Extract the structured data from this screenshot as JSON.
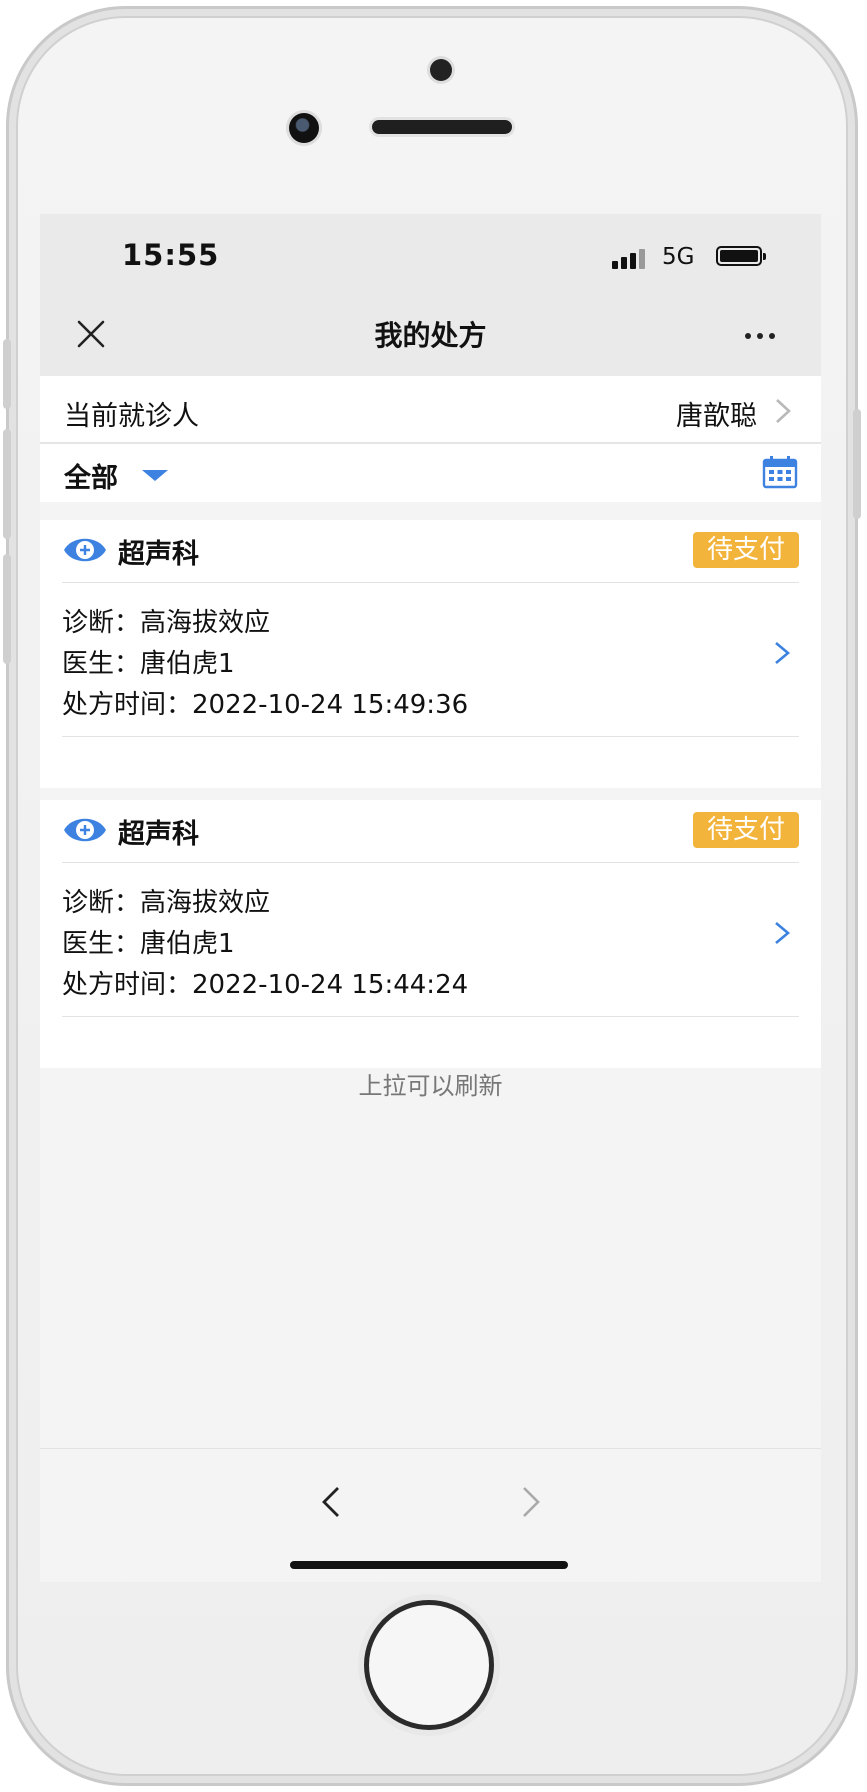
{
  "status_bar": {
    "time": "15:55",
    "network": "5G"
  },
  "nav": {
    "title": "我的处方"
  },
  "patient": {
    "label": "当前就诊人",
    "name": "唐歆聪"
  },
  "filter": {
    "label": "全部"
  },
  "prescriptions": [
    {
      "department": "超声科",
      "status": "待支付",
      "diagnosis_label": "诊断：",
      "diagnosis": "高海拔效应",
      "doctor_label": "医生：",
      "doctor": "唐伯虎1",
      "time_label": "处方时间：",
      "time": "2022-10-24 15:49:36"
    },
    {
      "department": "超声科",
      "status": "待支付",
      "diagnosis_label": "诊断：",
      "diagnosis": "高海拔效应",
      "doctor_label": "医生：",
      "doctor": "唐伯虎1",
      "time_label": "处方时间：",
      "time": "2022-10-24 15:44:24"
    }
  ],
  "footer_note": "上拉可以刷新",
  "colors": {
    "accent_blue": "#3d82e0",
    "badge_orange": "#f3b43b",
    "screen_bg": "#f4f4f4",
    "bar_bg": "#eaeaea"
  },
  "icons": [
    "close-icon",
    "more-icon",
    "chevron-right-icon",
    "caret-down-icon",
    "calendar-icon",
    "department-icon",
    "back-arrow-icon",
    "forward-arrow-icon"
  ]
}
